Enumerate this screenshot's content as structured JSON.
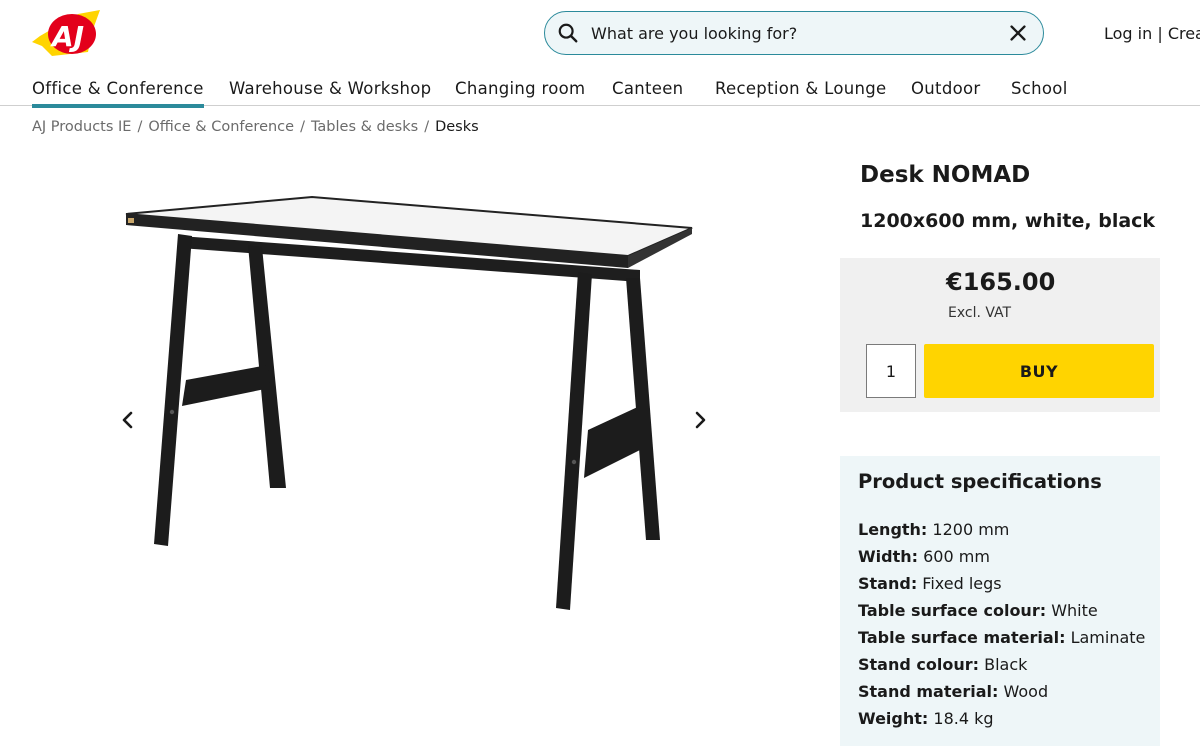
{
  "header": {
    "logo_text": "AJ",
    "search": {
      "placeholder": "What are you looking for?"
    },
    "account": {
      "login": "Log in",
      "separator": " | ",
      "create": "Creat"
    }
  },
  "nav": {
    "items": [
      {
        "label": "Office & Conference",
        "active": true
      },
      {
        "label": "Warehouse & Workshop"
      },
      {
        "label": "Changing room"
      },
      {
        "label": "Canteen"
      },
      {
        "label": "Reception & Lounge"
      },
      {
        "label": "Outdoor"
      },
      {
        "label": "School"
      }
    ]
  },
  "breadcrumb": {
    "items": [
      "AJ Products IE",
      "Office & Conference",
      "Tables & desks",
      "Desks"
    ],
    "separator": "/"
  },
  "product": {
    "title": "Desk NOMAD",
    "subtitle": "1200x600 mm, white, black",
    "price": "€165.00",
    "vat_note": "Excl. VAT",
    "quantity": "1",
    "buy_label": "BUY"
  },
  "specs": {
    "heading": "Product specifications",
    "rows": [
      {
        "key": "Length:",
        "value": " 1200 mm"
      },
      {
        "key": "Width:",
        "value": " 600 mm"
      },
      {
        "key": "Stand:",
        "value": " Fixed legs"
      },
      {
        "key": "Table surface colour:",
        "value": " White"
      },
      {
        "key": "Table surface material:",
        "value": " Laminate"
      },
      {
        "key": "Stand colour:",
        "value": " Black"
      },
      {
        "key": "Stand material:",
        "value": " Wood"
      },
      {
        "key": "Weight:",
        "value": " 18.4 kg"
      }
    ]
  },
  "colors": {
    "accent": "#2b8a9b",
    "buy_button": "#ffd400",
    "logo_red": "#e3001b",
    "logo_yellow": "#ffd400"
  },
  "icons": {
    "search": "search-icon",
    "clear": "close-icon",
    "prev": "chevron-left-icon",
    "next": "chevron-right-icon"
  }
}
